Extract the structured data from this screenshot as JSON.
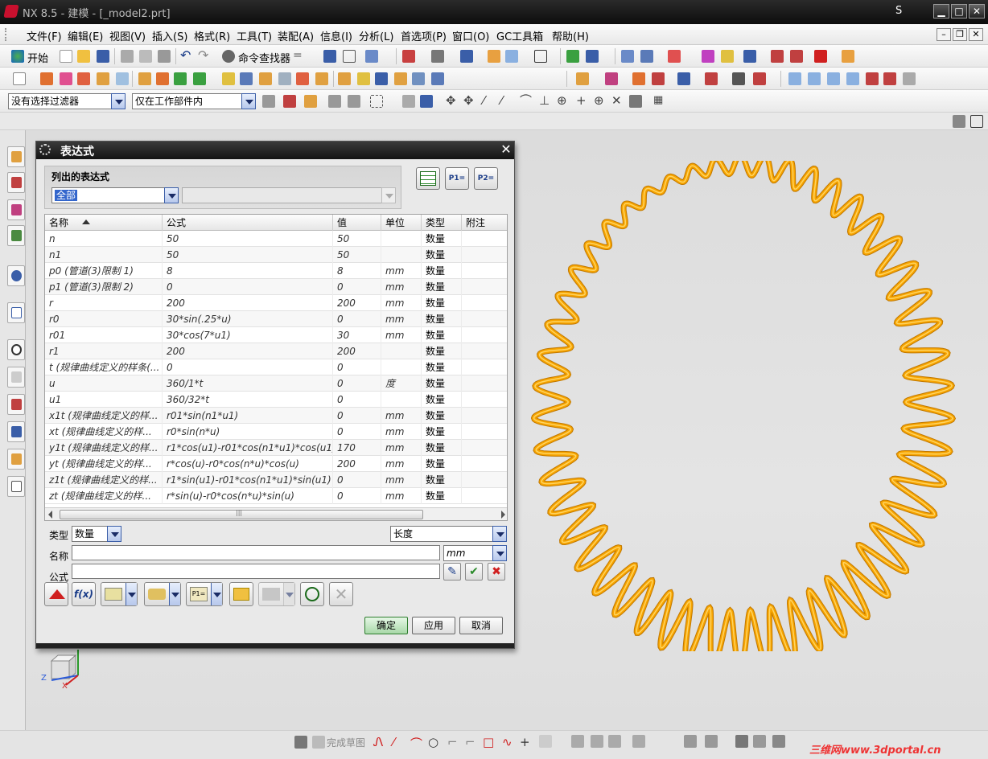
{
  "window": {
    "title": "NX 8.5 - 建模 - [_model2.prt]",
    "user_initial": "S",
    "minimize": "▁",
    "maximize": "□",
    "close": "✕"
  },
  "menu": {
    "items": [
      "文件(F)",
      "编辑(E)",
      "视图(V)",
      "插入(S)",
      "格式(R)",
      "工具(T)",
      "装配(A)",
      "信息(I)",
      "分析(L)",
      "首选项(P)",
      "窗口(O)",
      "GC工具箱",
      "帮助(H)"
    ]
  },
  "toolbar1": {
    "start_label": "开始",
    "command_finder": "命令查找器"
  },
  "selection_bar": {
    "filter_value": "没有选择过滤器",
    "scope_value": "仅在工作部件内"
  },
  "dialog": {
    "title": "表达式",
    "close": "✕",
    "list_group_label": "列出的表达式",
    "list_filter_value": "全部",
    "columns": [
      "名称",
      "公式",
      "值",
      "单位",
      "类型",
      "附注"
    ],
    "rows": [
      {
        "name": "n",
        "formula": "50",
        "value": "50",
        "unit": "",
        "type": "数量"
      },
      {
        "name": "n1",
        "formula": "50",
        "value": "50",
        "unit": "",
        "type": "数量"
      },
      {
        "name": "p0 (管道(3)限制 1)",
        "formula": "8",
        "value": "8",
        "unit": "mm",
        "type": "数量"
      },
      {
        "name": "p1 (管道(3)限制 2)",
        "formula": "0",
        "value": "0",
        "unit": "mm",
        "type": "数量"
      },
      {
        "name": "r",
        "formula": "200",
        "value": "200",
        "unit": "mm",
        "type": "数量"
      },
      {
        "name": "r0",
        "formula": "30*sin(.25*u)",
        "value": "0",
        "unit": "mm",
        "type": "数量"
      },
      {
        "name": "r01",
        "formula": "30*cos(7*u1)",
        "value": "30",
        "unit": "mm",
        "type": "数量"
      },
      {
        "name": "r1",
        "formula": "200",
        "value": "200",
        "unit": "",
        "type": "数量"
      },
      {
        "name": "t (规律曲线定义的样条(...",
        "formula": "0",
        "value": "0",
        "unit": "",
        "type": "数量"
      },
      {
        "name": "u",
        "formula": "360/1*t",
        "value": "0",
        "unit": "度",
        "type": "数量"
      },
      {
        "name": "u1",
        "formula": "360/32*t",
        "value": "0",
        "unit": "",
        "type": "数量"
      },
      {
        "name": "x1t (规律曲线定义的样...",
        "formula": "r01*sin(n1*u1)",
        "value": "0",
        "unit": "mm",
        "type": "数量"
      },
      {
        "name": "xt (规律曲线定义的样...",
        "formula": "r0*sin(n*u)",
        "value": "0",
        "unit": "mm",
        "type": "数量"
      },
      {
        "name": "y1t (规律曲线定义的样...",
        "formula": "r1*cos(u1)-r01*cos(n1*u1)*cos(u1)",
        "value": "170",
        "unit": "mm",
        "type": "数量"
      },
      {
        "name": "yt (规律曲线定义的样...",
        "formula": "r*cos(u)-r0*cos(n*u)*cos(u)",
        "value": "200",
        "unit": "mm",
        "type": "数量"
      },
      {
        "name": "z1t (规律曲线定义的样...",
        "formula": "r1*sin(u1)-r01*cos(n1*u1)*sin(u1)",
        "value": "0",
        "unit": "mm",
        "type": "数量"
      },
      {
        "name": "zt (规律曲线定义的样...",
        "formula": "r*sin(u)-r0*cos(n*u)*sin(u)",
        "value": "0",
        "unit": "mm",
        "type": "数量"
      }
    ],
    "type_label": "类型",
    "type_value": "数量",
    "dimension_value": "长度",
    "name_label": "名称",
    "unit_value": "mm",
    "formula_label": "公式",
    "ok": "确定",
    "apply": "应用",
    "cancel": "取消"
  },
  "bottom_bar": {
    "finish_sketch": "完成草图"
  },
  "triad": {
    "z": "Z",
    "x": "X"
  },
  "watermark": "三维网www.3dportal.cn",
  "colors": {
    "spring": "#f7a400",
    "accent": "#3c5fa8"
  }
}
